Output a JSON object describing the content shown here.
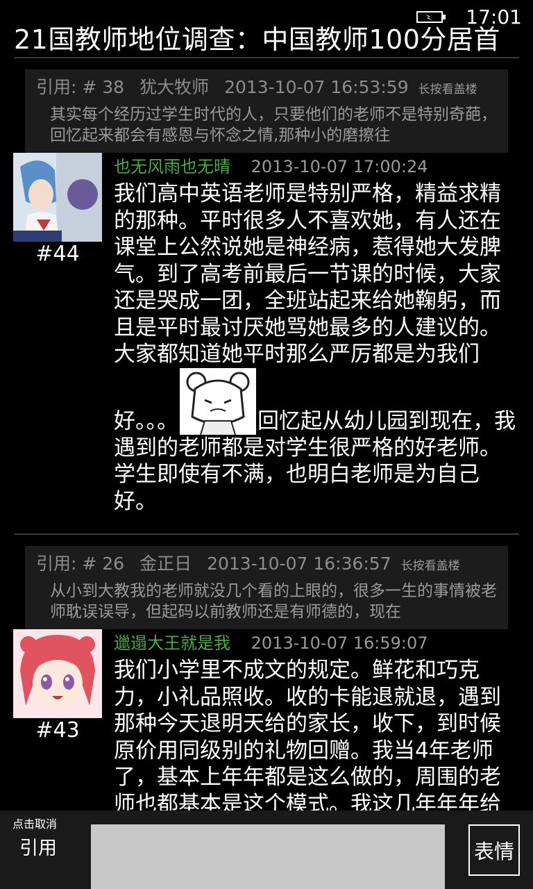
{
  "status": {
    "time": "17:01"
  },
  "title": "21国教师地位调查：中国教师100分居首",
  "posts": [
    {
      "quote": {
        "prefix": "引用: # 38",
        "user": "犹大牧师",
        "time": "2013-10-07 16:53:59",
        "hint": "长按看盖楼",
        "text": "其实每个经历过学生时代的人，只要他们的老师不是特别奇葩，回忆起来都会有感恩与怀念之情,那种小的磨擦往"
      },
      "floor": "#44",
      "user": "也无风雨也无晴",
      "time": "2013-10-07 17:00:24",
      "body_part1": "我们高中英语老师是特别严格，精益求精的那种。平时很多人不喜欢她，有人还在课堂上公然说她是神经病，惹得她大发脾气。到了高考前最后一节课的时候，大家还是哭成一团，全班站起来给她鞠躬，而且是平时最讨厌她骂她最多的人建议的。大家都知道她平时那么严厉都是为我们",
      "body_part2_before": "好。。。",
      "body_part2_after": "回忆起从幼儿园到现在，我遇到的老师都是对学生很严格的好老师。学生即使有不满，也明白老师是为自己好。"
    },
    {
      "quote": {
        "prefix": "引用: # 26",
        "user": "金正日",
        "time": "2013-10-07 16:36:57",
        "hint": "长按看盖楼",
        "text": "从小到大教我的老师就没几个看的上眼的，很多一生的事情被老师耽误误导，但起码以前教师还是有师德的，现在"
      },
      "floor": "#43",
      "user": "邋遢大王就是我",
      "time": "2013-10-07 16:59:07",
      "body": "我们小学里不成文的规定。鲜花和巧克力，小礼品照收。收的卡能退就退，遇到那种今天退明天给的家长，收下，到时候原价用同级别的礼物回赠。我当4年老师了，基本上年年都是这么做的，周围的老师也都基本是这个模式。我这几年年年给"
    }
  ],
  "bottom": {
    "cancel_hint": "点击取消",
    "quote_label": "引用",
    "input_placeholder": "",
    "emoji_label": "表情"
  },
  "colors": {
    "background": "#000000",
    "quote_bg": "#1c1c1c",
    "username_green": "#4fa84a",
    "meta_gray": "#9a9a9a",
    "bottom_bar": "#1a1a1a",
    "input_bg": "#c8c8c8"
  }
}
